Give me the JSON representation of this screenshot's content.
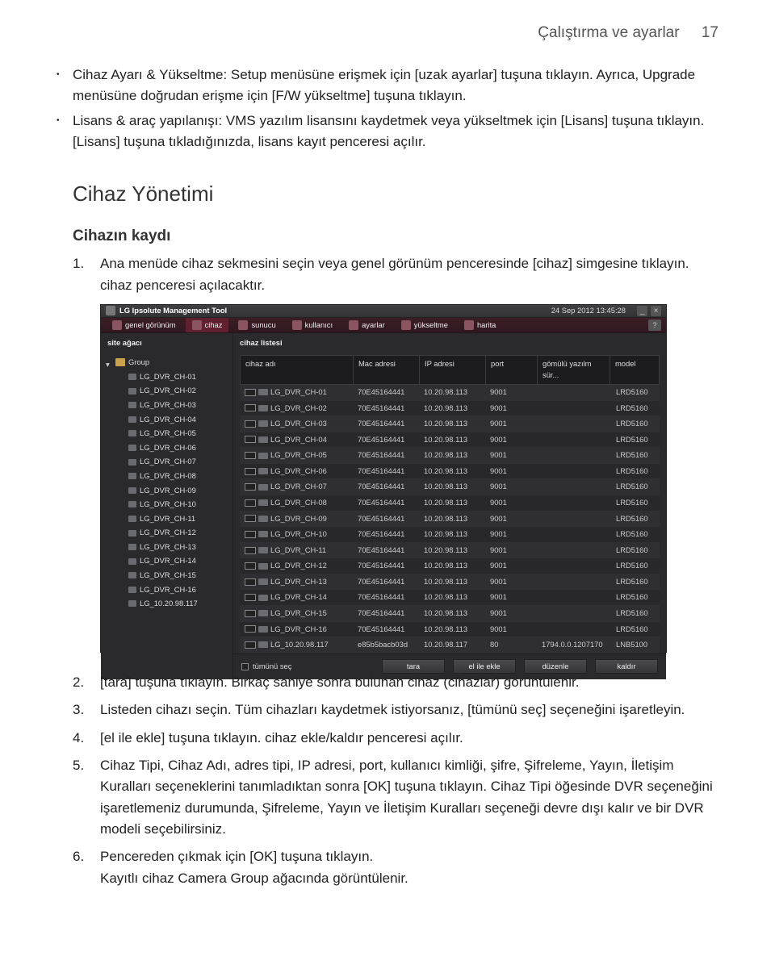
{
  "header": {
    "title": "Çalıştırma ve ayarlar",
    "page": "17"
  },
  "bullets": [
    "Cihaz Ayarı & Yükseltme: Setup menüsüne erişmek için [uzak ayarlar] tuşuna tıklayın. Ayrıca, Upgrade menüsüne doğrudan erişme için [F/W yükseltme] tuşuna tıklayın.",
    "Lisans & araç yapılanışı: VMS yazılım lisansını kaydetmek veya yükseltmek için [Lisans] tuşuna tıklayın. [Lisans] tuşuna tıkladığınızda, lisans kayıt penceresi açılır."
  ],
  "section": "Cihaz Yönetimi",
  "sub": "Cihazın kaydı",
  "step1": "Ana menüde cihaz sekmesini seçin veya genel görünüm penceresinde [cihaz] simgesine tıklayın. cihaz penceresi açılacaktır.",
  "step2": "[tara] tuşuna tıklayın. Birkaç saniye sonra bulunan cihaz (cihazlar) görüntülenir.",
  "step3": "Listeden cihazı seçin. Tüm cihazları kaydetmek istiyorsanız, [tümünü seç] seçeneğini işaretleyin.",
  "step4": "[el ile ekle] tuşuna tıklayın. cihaz ekle/kaldır penceresi açılır.",
  "step5": "Cihaz Tipi, Cihaz Adı, adres tipi, IP adresi, port, kullanıcı kimliği, şifre, Şifreleme, Yayın, İletişim Kuralları seçeneklerini tanımladıktan sonra [OK] tuşuna tıklayın. Cihaz Tipi öğesinde DVR seçeneğini işaretlemeniz durumunda, Şifreleme, Yayın ve İletişim Kuralları seçeneği devre dışı kalır ve bir DVR modeli seçebilirsiniz.",
  "step6a": "Pencereden çıkmak için [OK] tuşuna tıklayın.",
  "step6b": "Kayıtlı cihaz Camera Group ağacında görüntülenir.",
  "shot": {
    "title": "LG Ipsolute Management Tool",
    "datetime": "24 Sep 2012 13:45:28",
    "toolbar": {
      "overview": "genel görünüm",
      "device": "cihaz",
      "server": "sunucu",
      "user": "kullanıcı",
      "settings": "ayarlar",
      "upgrade": "yükseltme",
      "map": "harita"
    },
    "tree_header": "site ağacı",
    "group_label": "Group",
    "list_header": "cihaz listesi",
    "cols": {
      "name": "cihaz adı",
      "mac": "Mac adresi",
      "ip": "IP adresi",
      "port": "port",
      "fw": "gömülü yazılm sür...",
      "model": "model"
    },
    "tree_items": [
      "LG_DVR_CH-01",
      "LG_DVR_CH-02",
      "LG_DVR_CH-03",
      "LG_DVR_CH-04",
      "LG_DVR_CH-05",
      "LG_DVR_CH-06",
      "LG_DVR_CH-07",
      "LG_DVR_CH-08",
      "LG_DVR_CH-09",
      "LG_DVR_CH-10",
      "LG_DVR_CH-11",
      "LG_DVR_CH-12",
      "LG_DVR_CH-13",
      "LG_DVR_CH-14",
      "LG_DVR_CH-15",
      "LG_DVR_CH-16",
      "LG_10.20.98.117"
    ],
    "rows": [
      {
        "name": "LG_DVR_CH-01",
        "mac": "70E45164441",
        "ip": "10.20.98.113",
        "port": "9001",
        "fw": "",
        "model": "LRD5160"
      },
      {
        "name": "LG_DVR_CH-02",
        "mac": "70E45164441",
        "ip": "10.20.98.113",
        "port": "9001",
        "fw": "",
        "model": "LRD5160"
      },
      {
        "name": "LG_DVR_CH-03",
        "mac": "70E45164441",
        "ip": "10.20.98.113",
        "port": "9001",
        "fw": "",
        "model": "LRD5160"
      },
      {
        "name": "LG_DVR_CH-04",
        "mac": "70E45164441",
        "ip": "10.20.98.113",
        "port": "9001",
        "fw": "",
        "model": "LRD5160"
      },
      {
        "name": "LG_DVR_CH-05",
        "mac": "70E45164441",
        "ip": "10.20.98.113",
        "port": "9001",
        "fw": "",
        "model": "LRD5160"
      },
      {
        "name": "LG_DVR_CH-06",
        "mac": "70E45164441",
        "ip": "10.20.98.113",
        "port": "9001",
        "fw": "",
        "model": "LRD5160"
      },
      {
        "name": "LG_DVR_CH-07",
        "mac": "70E45164441",
        "ip": "10.20.98.113",
        "port": "9001",
        "fw": "",
        "model": "LRD5160"
      },
      {
        "name": "LG_DVR_CH-08",
        "mac": "70E45164441",
        "ip": "10.20.98.113",
        "port": "9001",
        "fw": "",
        "model": "LRD5160"
      },
      {
        "name": "LG_DVR_CH-09",
        "mac": "70E45164441",
        "ip": "10.20.98.113",
        "port": "9001",
        "fw": "",
        "model": "LRD5160"
      },
      {
        "name": "LG_DVR_CH-10",
        "mac": "70E45164441",
        "ip": "10.20.98.113",
        "port": "9001",
        "fw": "",
        "model": "LRD5160"
      },
      {
        "name": "LG_DVR_CH-11",
        "mac": "70E45164441",
        "ip": "10.20.98.113",
        "port": "9001",
        "fw": "",
        "model": "LRD5160"
      },
      {
        "name": "LG_DVR_CH-12",
        "mac": "70E45164441",
        "ip": "10.20.98.113",
        "port": "9001",
        "fw": "",
        "model": "LRD5160"
      },
      {
        "name": "LG_DVR_CH-13",
        "mac": "70E45164441",
        "ip": "10.20.98.113",
        "port": "9001",
        "fw": "",
        "model": "LRD5160"
      },
      {
        "name": "LG_DVR_CH-14",
        "mac": "70E45164441",
        "ip": "10.20.98.113",
        "port": "9001",
        "fw": "",
        "model": "LRD5160"
      },
      {
        "name": "LG_DVR_CH-15",
        "mac": "70E45164441",
        "ip": "10.20.98.113",
        "port": "9001",
        "fw": "",
        "model": "LRD5160"
      },
      {
        "name": "LG_DVR_CH-16",
        "mac": "70E45164441",
        "ip": "10.20.98.113",
        "port": "9001",
        "fw": "",
        "model": "LRD5160"
      },
      {
        "name": "LG_10.20.98.117",
        "mac": "e85b5bacb03d",
        "ip": "10.20.98.117",
        "port": "80",
        "fw": "1794.0.0.1207170",
        "model": "LNB5100"
      }
    ],
    "select_all": "tümünü seç",
    "buttons": {
      "scan": "tara",
      "manual": "el ile ekle",
      "edit": "düzenle",
      "remove": "kaldır"
    }
  }
}
